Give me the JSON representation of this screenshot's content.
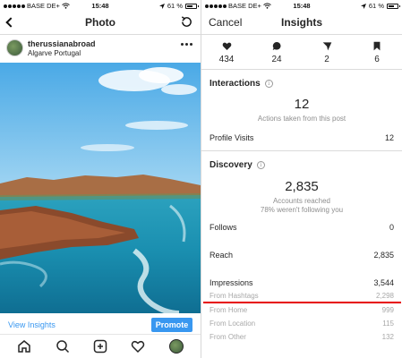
{
  "status_bar": {
    "carrier": "BASE DE+",
    "time": "15:48",
    "battery": "61 %"
  },
  "left_screen": {
    "nav_title": "Photo",
    "post": {
      "username": "therussianabroad",
      "location": "Algarve Portugal"
    },
    "view_insights_label": "View Insights",
    "promote_label": "Promote",
    "tabs": [
      "home-icon",
      "search-icon",
      "add-icon",
      "heart-icon",
      "profile-avatar"
    ]
  },
  "right_screen": {
    "cancel_label": "Cancel",
    "nav_title": "Insights",
    "stats": [
      {
        "icon": "heart-icon",
        "value": "434"
      },
      {
        "icon": "comment-icon",
        "value": "24"
      },
      {
        "icon": "send-icon",
        "value": "2"
      },
      {
        "icon": "bookmark-icon",
        "value": "6"
      }
    ],
    "interactions": {
      "title": "Interactions",
      "total": "12",
      "caption": "Actions taken from this post",
      "rows": [
        {
          "label": "Profile Visits",
          "value": "12"
        }
      ]
    },
    "discovery": {
      "title": "Discovery",
      "total": "2,835",
      "caption_1": "Accounts reached",
      "caption_2": "78% weren't following you",
      "rows": [
        {
          "label": "Follows",
          "value": "0"
        },
        {
          "label": "Reach",
          "value": "2,835"
        },
        {
          "label": "Impressions",
          "value": "3,544"
        }
      ],
      "sub_rows": [
        {
          "label": "From Hashtags",
          "value": "2,298"
        },
        {
          "label": "From Home",
          "value": "999"
        },
        {
          "label": "From Location",
          "value": "115"
        },
        {
          "label": "From Other",
          "value": "132"
        }
      ]
    },
    "highlight_color": "#e60000"
  },
  "colors": {
    "accent_blue": "#3897f0",
    "text": "#262626",
    "muted": "#8e8e8e"
  }
}
